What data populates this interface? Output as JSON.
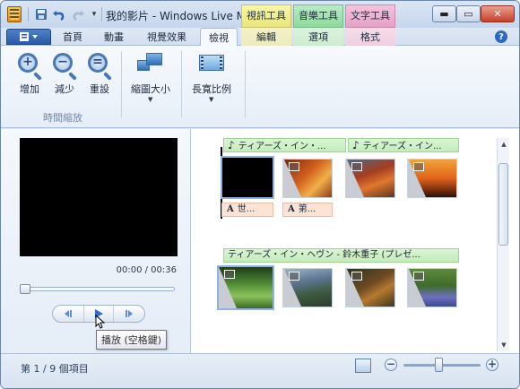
{
  "window": {
    "title": "我的影片 - Windows Live Mo...",
    "context_tabs": [
      "視訊工具",
      "音樂工具",
      "文字工具"
    ],
    "controls": {
      "minimize": "▬",
      "maximize": "▭",
      "close": "✕"
    }
  },
  "quick_access": {
    "save_icon": "save-icon",
    "undo_icon": "undo-icon",
    "redo_icon": "redo-icon",
    "customize": "▾"
  },
  "tabs": {
    "file_icon": "menu-icon",
    "items": [
      "首頁",
      "動畫",
      "視覺效果",
      "檢視",
      "編輯",
      "選項",
      "格式"
    ],
    "active": "檢視"
  },
  "ribbon": {
    "zoom_group": {
      "label": "時間縮放",
      "zoom_in": "增加",
      "zoom_out": "減少",
      "reset": "重設"
    },
    "thumbnail_size": "縮圖大小",
    "aspect_ratio": "長寬比例"
  },
  "preview": {
    "time": "00:00 / 00:36",
    "seek_position": 0,
    "tooltip": "播放 (空格鍵)"
  },
  "storyboard": {
    "music_track_1a": "ティアーズ・イン・...",
    "music_track_1b": "ティアーズ・イン...",
    "music_track_2": "ティアーズ・イン・ヘヴン - 鈴木重子 (プレゼ...",
    "caption_1": "世...",
    "caption_2": "第...",
    "clips_row1": [
      "black-clip",
      "autumn-trees",
      "autumn-forest",
      "sunset-tree"
    ],
    "clips_row2": [
      "forest-path",
      "mountain-lake",
      "squirrel",
      "bluebell-woods"
    ]
  },
  "status": {
    "item_count": "第 1 / 9 個項目",
    "zoom_level": 0.45
  },
  "colors": {
    "accent": "#2f66c0",
    "video_tools": "#fbf7a8",
    "music_tools": "#b9ecc2",
    "text_tools": "#f4c4de",
    "music_bar": "#c3ecba",
    "caption_bar": "#fbe4d6"
  }
}
